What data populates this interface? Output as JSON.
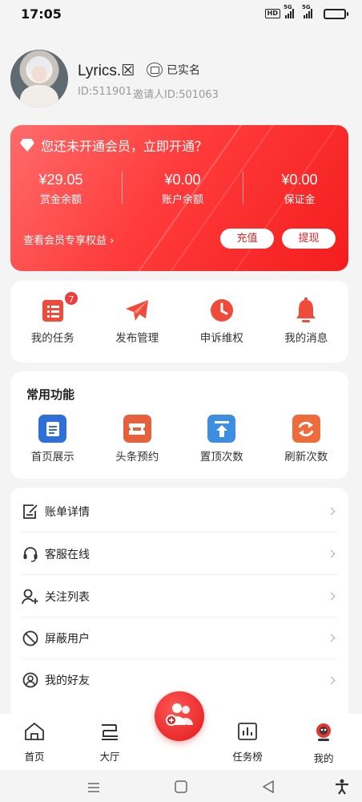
{
  "status_bar": {
    "time": "17:05",
    "network_1": "5G",
    "network_2": "5G",
    "hd": "HD"
  },
  "profile": {
    "name": "Lyrics.☒",
    "verified_label": "已实名",
    "id_text": "ID:511901",
    "inviter_text": "邀请人ID:501063"
  },
  "vip": {
    "title": "您还未开通会员，立即开通？",
    "stats": [
      {
        "value": "¥29.05",
        "label": "赏金余额"
      },
      {
        "value": "¥0.00",
        "label": "账户余额"
      },
      {
        "value": "¥0.00",
        "label": "保证金"
      }
    ],
    "benefits_link": "查看会员专享权益 ›",
    "recharge_label": "充值",
    "withdraw_label": "提现"
  },
  "quick_actions": [
    {
      "label": "我的任务",
      "icon": "task-list-icon",
      "badge": "7"
    },
    {
      "label": "发布管理",
      "icon": "paper-plane-icon"
    },
    {
      "label": "申诉维权",
      "icon": "clock-icon"
    },
    {
      "label": "我的消息",
      "icon": "bell-icon"
    }
  ],
  "common_functions": {
    "title": "常用功能",
    "items": [
      {
        "label": "首页展示",
        "icon": "document-icon",
        "color": "#2f6fd8"
      },
      {
        "label": "头条预约",
        "icon": "ticket-icon",
        "color": "#e5603b"
      },
      {
        "label": "置顶次数",
        "icon": "pin-top-icon",
        "color": "#3d8ee0"
      },
      {
        "label": "刷新次数",
        "icon": "refresh-icon",
        "color": "#ee6b3a"
      }
    ]
  },
  "menu": [
    {
      "label": "账单详情",
      "icon": "bill-edit-icon"
    },
    {
      "label": "客服在线",
      "icon": "headset-icon"
    },
    {
      "label": "关注列表",
      "icon": "user-add-icon"
    },
    {
      "label": "屏蔽用户",
      "icon": "block-icon"
    },
    {
      "label": "我的好友",
      "icon": "friend-icon"
    }
  ],
  "tabbar": [
    {
      "label": "首页",
      "icon": "home-icon"
    },
    {
      "label": "大厅",
      "icon": "hall-icon"
    },
    {
      "label": "任务榜",
      "icon": "ranking-icon"
    },
    {
      "label": "我的",
      "icon": "profile-icon",
      "active": true
    }
  ],
  "colors": {
    "accent": "#f23a3a",
    "background": "#f4f4f5"
  }
}
